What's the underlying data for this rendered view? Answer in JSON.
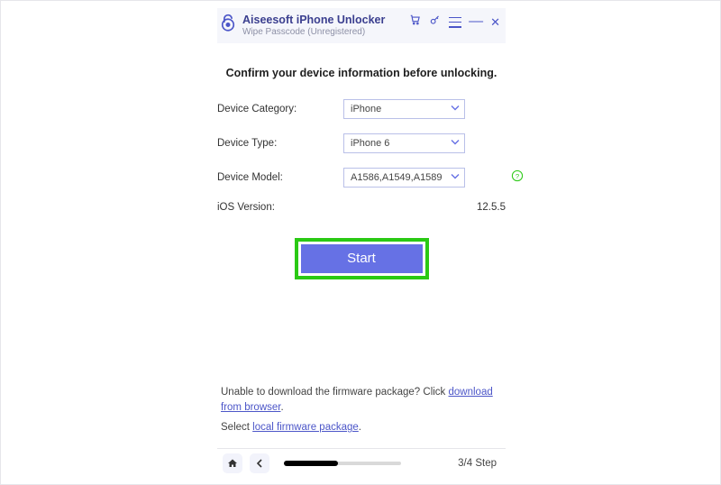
{
  "header": {
    "title": "Aiseesoft iPhone Unlocker",
    "subtitle": "Wipe Passcode  (Unregistered)"
  },
  "headicons": {
    "cart": "cart-icon",
    "key": "key-icon",
    "menu": "menu-icon",
    "min": "minimize-icon",
    "close": "close-icon"
  },
  "heading": "Confirm your device information before unlocking.",
  "form": {
    "category_label": "Device Category:",
    "category_value": "iPhone",
    "type_label": "Device Type:",
    "type_value": "iPhone 6",
    "model_label": "Device Model:",
    "model_value": "A1586,A1549,A1589",
    "ios_label": "iOS Version:",
    "ios_value": "12.5.5"
  },
  "start_label": "Start",
  "bottom": {
    "line1a": "Unable to download the firmware package? Click ",
    "link1": "download from browser",
    "line1b": ".",
    "line2a": "Select ",
    "link2": "local firmware package",
    "line2b": "."
  },
  "footer": {
    "step": "3/4 Step"
  }
}
